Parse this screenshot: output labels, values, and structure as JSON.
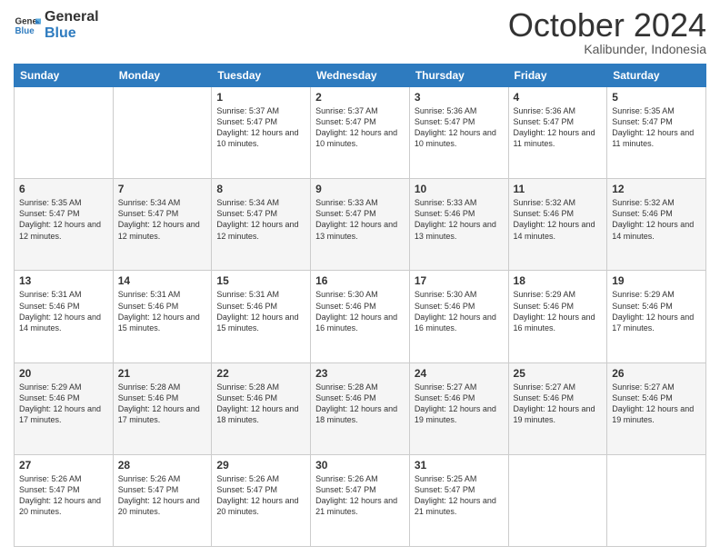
{
  "header": {
    "logo_line1": "General",
    "logo_line2": "Blue",
    "month_title": "October 2024",
    "location": "Kalibunder, Indonesia"
  },
  "calendar": {
    "days_of_week": [
      "Sunday",
      "Monday",
      "Tuesday",
      "Wednesday",
      "Thursday",
      "Friday",
      "Saturday"
    ],
    "weeks": [
      [
        {
          "day": "",
          "sunrise": "",
          "sunset": "",
          "daylight": ""
        },
        {
          "day": "",
          "sunrise": "",
          "sunset": "",
          "daylight": ""
        },
        {
          "day": "1",
          "sunrise": "Sunrise: 5:37 AM",
          "sunset": "Sunset: 5:47 PM",
          "daylight": "Daylight: 12 hours and 10 minutes."
        },
        {
          "day": "2",
          "sunrise": "Sunrise: 5:37 AM",
          "sunset": "Sunset: 5:47 PM",
          "daylight": "Daylight: 12 hours and 10 minutes."
        },
        {
          "day": "3",
          "sunrise": "Sunrise: 5:36 AM",
          "sunset": "Sunset: 5:47 PM",
          "daylight": "Daylight: 12 hours and 10 minutes."
        },
        {
          "day": "4",
          "sunrise": "Sunrise: 5:36 AM",
          "sunset": "Sunset: 5:47 PM",
          "daylight": "Daylight: 12 hours and 11 minutes."
        },
        {
          "day": "5",
          "sunrise": "Sunrise: 5:35 AM",
          "sunset": "Sunset: 5:47 PM",
          "daylight": "Daylight: 12 hours and 11 minutes."
        }
      ],
      [
        {
          "day": "6",
          "sunrise": "Sunrise: 5:35 AM",
          "sunset": "Sunset: 5:47 PM",
          "daylight": "Daylight: 12 hours and 12 minutes."
        },
        {
          "day": "7",
          "sunrise": "Sunrise: 5:34 AM",
          "sunset": "Sunset: 5:47 PM",
          "daylight": "Daylight: 12 hours and 12 minutes."
        },
        {
          "day": "8",
          "sunrise": "Sunrise: 5:34 AM",
          "sunset": "Sunset: 5:47 PM",
          "daylight": "Daylight: 12 hours and 12 minutes."
        },
        {
          "day": "9",
          "sunrise": "Sunrise: 5:33 AM",
          "sunset": "Sunset: 5:47 PM",
          "daylight": "Daylight: 12 hours and 13 minutes."
        },
        {
          "day": "10",
          "sunrise": "Sunrise: 5:33 AM",
          "sunset": "Sunset: 5:46 PM",
          "daylight": "Daylight: 12 hours and 13 minutes."
        },
        {
          "day": "11",
          "sunrise": "Sunrise: 5:32 AM",
          "sunset": "Sunset: 5:46 PM",
          "daylight": "Daylight: 12 hours and 14 minutes."
        },
        {
          "day": "12",
          "sunrise": "Sunrise: 5:32 AM",
          "sunset": "Sunset: 5:46 PM",
          "daylight": "Daylight: 12 hours and 14 minutes."
        }
      ],
      [
        {
          "day": "13",
          "sunrise": "Sunrise: 5:31 AM",
          "sunset": "Sunset: 5:46 PM",
          "daylight": "Daylight: 12 hours and 14 minutes."
        },
        {
          "day": "14",
          "sunrise": "Sunrise: 5:31 AM",
          "sunset": "Sunset: 5:46 PM",
          "daylight": "Daylight: 12 hours and 15 minutes."
        },
        {
          "day": "15",
          "sunrise": "Sunrise: 5:31 AM",
          "sunset": "Sunset: 5:46 PM",
          "daylight": "Daylight: 12 hours and 15 minutes."
        },
        {
          "day": "16",
          "sunrise": "Sunrise: 5:30 AM",
          "sunset": "Sunset: 5:46 PM",
          "daylight": "Daylight: 12 hours and 16 minutes."
        },
        {
          "day": "17",
          "sunrise": "Sunrise: 5:30 AM",
          "sunset": "Sunset: 5:46 PM",
          "daylight": "Daylight: 12 hours and 16 minutes."
        },
        {
          "day": "18",
          "sunrise": "Sunrise: 5:29 AM",
          "sunset": "Sunset: 5:46 PM",
          "daylight": "Daylight: 12 hours and 16 minutes."
        },
        {
          "day": "19",
          "sunrise": "Sunrise: 5:29 AM",
          "sunset": "Sunset: 5:46 PM",
          "daylight": "Daylight: 12 hours and 17 minutes."
        }
      ],
      [
        {
          "day": "20",
          "sunrise": "Sunrise: 5:29 AM",
          "sunset": "Sunset: 5:46 PM",
          "daylight": "Daylight: 12 hours and 17 minutes."
        },
        {
          "day": "21",
          "sunrise": "Sunrise: 5:28 AM",
          "sunset": "Sunset: 5:46 PM",
          "daylight": "Daylight: 12 hours and 17 minutes."
        },
        {
          "day": "22",
          "sunrise": "Sunrise: 5:28 AM",
          "sunset": "Sunset: 5:46 PM",
          "daylight": "Daylight: 12 hours and 18 minutes."
        },
        {
          "day": "23",
          "sunrise": "Sunrise: 5:28 AM",
          "sunset": "Sunset: 5:46 PM",
          "daylight": "Daylight: 12 hours and 18 minutes."
        },
        {
          "day": "24",
          "sunrise": "Sunrise: 5:27 AM",
          "sunset": "Sunset: 5:46 PM",
          "daylight": "Daylight: 12 hours and 19 minutes."
        },
        {
          "day": "25",
          "sunrise": "Sunrise: 5:27 AM",
          "sunset": "Sunset: 5:46 PM",
          "daylight": "Daylight: 12 hours and 19 minutes."
        },
        {
          "day": "26",
          "sunrise": "Sunrise: 5:27 AM",
          "sunset": "Sunset: 5:46 PM",
          "daylight": "Daylight: 12 hours and 19 minutes."
        }
      ],
      [
        {
          "day": "27",
          "sunrise": "Sunrise: 5:26 AM",
          "sunset": "Sunset: 5:47 PM",
          "daylight": "Daylight: 12 hours and 20 minutes."
        },
        {
          "day": "28",
          "sunrise": "Sunrise: 5:26 AM",
          "sunset": "Sunset: 5:47 PM",
          "daylight": "Daylight: 12 hours and 20 minutes."
        },
        {
          "day": "29",
          "sunrise": "Sunrise: 5:26 AM",
          "sunset": "Sunset: 5:47 PM",
          "daylight": "Daylight: 12 hours and 20 minutes."
        },
        {
          "day": "30",
          "sunrise": "Sunrise: 5:26 AM",
          "sunset": "Sunset: 5:47 PM",
          "daylight": "Daylight: 12 hours and 21 minutes."
        },
        {
          "day": "31",
          "sunrise": "Sunrise: 5:25 AM",
          "sunset": "Sunset: 5:47 PM",
          "daylight": "Daylight: 12 hours and 21 minutes."
        },
        {
          "day": "",
          "sunrise": "",
          "sunset": "",
          "daylight": ""
        },
        {
          "day": "",
          "sunrise": "",
          "sunset": "",
          "daylight": ""
        }
      ]
    ]
  }
}
